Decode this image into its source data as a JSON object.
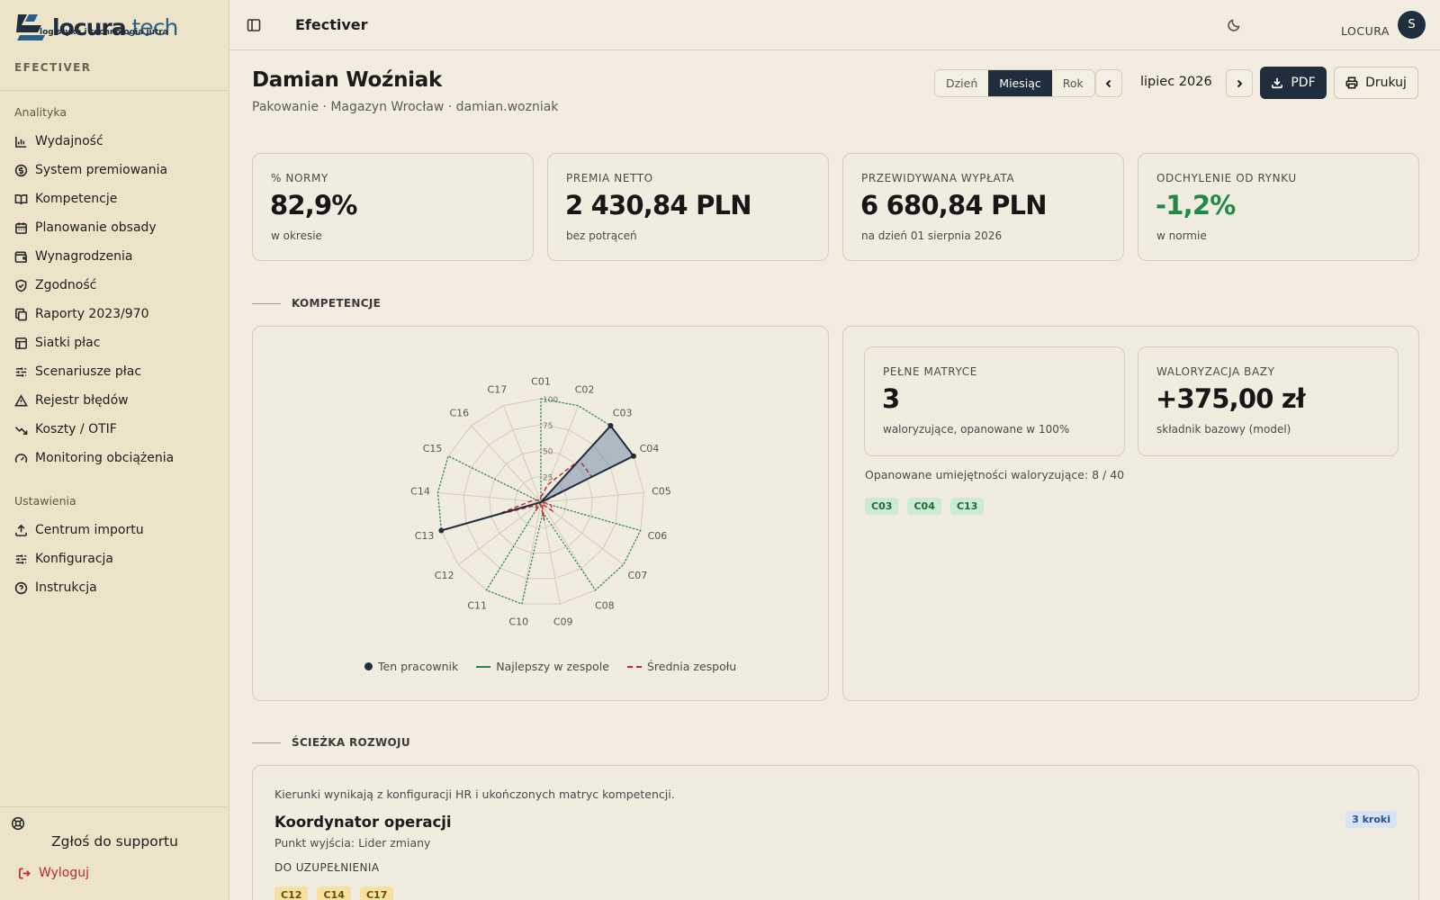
{
  "brand": {
    "name_main": "locura",
    "name_tld": ".tech",
    "tagline": "logistyka i technologia jutra",
    "caption": "EFECTIVER"
  },
  "sidebar": {
    "analytics_label": "Analityka",
    "analytics": [
      {
        "label": "Wydajność",
        "icon": "bar-chart-icon"
      },
      {
        "label": "System premiowania",
        "icon": "coin-icon"
      },
      {
        "label": "Kompetencje",
        "icon": "book-icon"
      },
      {
        "label": "Planowanie obsady",
        "icon": "calendar-icon"
      },
      {
        "label": "Wynagrodzenia",
        "icon": "wallet-icon"
      },
      {
        "label": "Zgodność",
        "icon": "shield-icon"
      },
      {
        "label": "Raporty 2023/970",
        "icon": "copy-icon"
      },
      {
        "label": "Siatki płac",
        "icon": "grid-icon"
      },
      {
        "label": "Scenariusze płac",
        "icon": "sliders-icon"
      },
      {
        "label": "Rejestr błędów",
        "icon": "warning-icon"
      },
      {
        "label": "Koszty / OTIF",
        "icon": "trend-down-icon"
      },
      {
        "label": "Monitoring obciążenia",
        "icon": "gauge-icon"
      }
    ],
    "settings_label": "Ustawienia",
    "settings": [
      {
        "label": "Centrum importu",
        "icon": "upload-icon"
      },
      {
        "label": "Konfiguracja",
        "icon": "sliders-icon"
      },
      {
        "label": "Instrukcja",
        "icon": "help-icon"
      }
    ],
    "support_label": "Zgłoś do supportu",
    "logout_label": "Wyloguj"
  },
  "topbar": {
    "title": "Efectiver",
    "user": "LOCURA",
    "avatar_initial": "S"
  },
  "page": {
    "title": "Damian Woźniak",
    "subtitle": "Pakowanie · Magazyn Wrocław · damian.wozniak",
    "periods": [
      "Dzień",
      "Miesiąc",
      "Rok"
    ],
    "active_period": "Miesiąc",
    "current_period": "lipiec 2026",
    "pdf_label": "PDF",
    "print_label": "Drukuj"
  },
  "kpis": [
    {
      "label": "% NORMY",
      "value": "82,9%",
      "note": "w okresie"
    },
    {
      "label": "PREMIA NETTO",
      "value": "2 430,84 PLN",
      "note": "bez potrąceń"
    },
    {
      "label": "PRZEWIDYWANA WYPŁATA",
      "value": "6 680,84 PLN",
      "note": "na dzień 01 sierpnia 2026"
    },
    {
      "label": "ODCHYLENIE OD RYNKU",
      "value": "-1,2%",
      "note": "w normie",
      "value_color": "#1f8a48"
    }
  ],
  "competencies": {
    "section_title": "KOMPETENCJE",
    "radar": {
      "axes": [
        "C01",
        "C02",
        "C03",
        "C04",
        "C05",
        "C06",
        "C07",
        "C08",
        "C09",
        "C10",
        "C11",
        "C12",
        "C13",
        "C14",
        "C15",
        "C16",
        "C17"
      ],
      "ticks": [
        "25",
        "50",
        "75",
        "100"
      ],
      "max": 100,
      "series": [
        {
          "name": "Ten pracownik",
          "color": "#1f2d3d",
          "values": [
            0,
            0,
            100,
            100,
            0,
            0,
            0,
            0,
            0,
            0,
            0,
            0,
            100,
            0,
            0,
            0,
            0
          ]
        },
        {
          "name": "Najlepszy w zespole",
          "color": "#1f8a48",
          "values": [
            100,
            100,
            100,
            100,
            0,
            100,
            100,
            100,
            10,
            100,
            100,
            0,
            100,
            100,
            100,
            0,
            0
          ]
        },
        {
          "name": "Średnia zespołu",
          "color": "#c0282d",
          "values": [
            5,
            18,
            55,
            55,
            2,
            10,
            14,
            2,
            18,
            2,
            10,
            5,
            45,
            10,
            5,
            2,
            2
          ]
        }
      ]
    },
    "full_matrices": {
      "label": "PEŁNE MATRYCE",
      "value": "3",
      "note": "waloryzujące, opanowane w 100%"
    },
    "base_valorization": {
      "label": "WALORYZACJA BAZY",
      "value": "+375,00 zł",
      "note": "składnik bazowy (model)"
    },
    "mastered_note": "Opanowane umiejętności waloryzujące: 8 / 40",
    "mastered_chips": [
      "C03",
      "C04",
      "C13"
    ]
  },
  "development": {
    "section_title": "ŚCIEŻKA ROZWOJU",
    "intro": "Kierunki wynikają z konfiguracji HR i ukończonych matryc kompetencji.",
    "target": "Koordynator operacji",
    "start": "Punkt wyjścia: Lider zmiany",
    "steps_badge": "3 kroki",
    "todo_label": "DO UZUPEŁNIENIA",
    "todo_chips": [
      "C12",
      "C14",
      "C17"
    ]
  }
}
